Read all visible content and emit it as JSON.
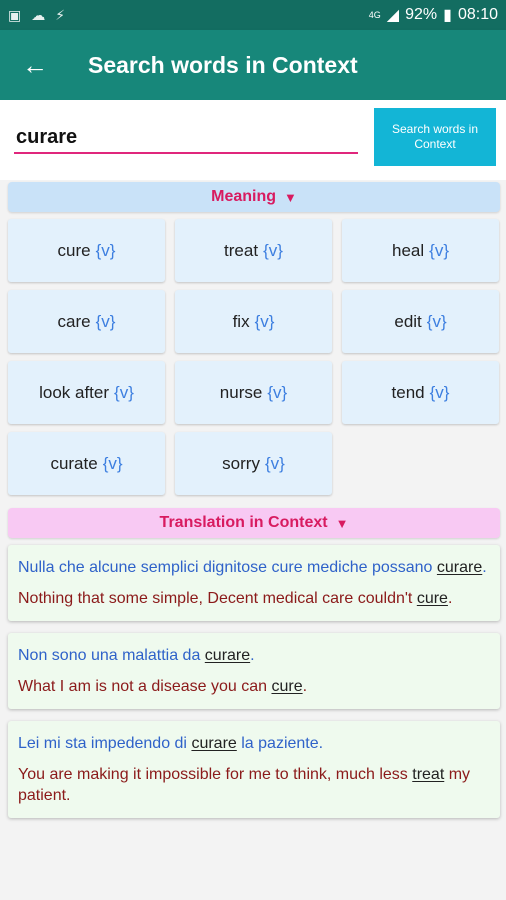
{
  "status": {
    "network": "4G",
    "battery": "92%",
    "time": "08:10"
  },
  "appbar": {
    "title": "Search words in Context"
  },
  "search": {
    "value": "curare",
    "button_label": "Search words in Context"
  },
  "meaning": {
    "label": "Meaning",
    "items": [
      {
        "word": "cure",
        "pos": "{v}"
      },
      {
        "word": "treat",
        "pos": "{v}"
      },
      {
        "word": "heal",
        "pos": "{v}"
      },
      {
        "word": "care",
        "pos": "{v}"
      },
      {
        "word": "fix",
        "pos": "{v}"
      },
      {
        "word": "edit",
        "pos": "{v}"
      },
      {
        "word": "look after",
        "pos": "{v}"
      },
      {
        "word": "nurse",
        "pos": "{v}"
      },
      {
        "word": "tend",
        "pos": "{v}"
      },
      {
        "word": "curate",
        "pos": "{v}"
      },
      {
        "word": "sorry",
        "pos": "{v}"
      }
    ]
  },
  "translation": {
    "label": "Translation in Context",
    "examples": [
      {
        "src_before": "Nulla che alcune semplici dignitose cure mediche possano ",
        "src_key": "curare",
        "src_after": ".",
        "tgt_before": "Nothing that some simple, Decent medical care couldn't ",
        "tgt_key": "cure",
        "tgt_after": "."
      },
      {
        "src_before": "Non sono una malattia da ",
        "src_key": "curare",
        "src_after": ".",
        "tgt_before": "What I am is not a disease you can ",
        "tgt_key": "cure",
        "tgt_after": "."
      },
      {
        "src_before": "Lei mi sta impedendo di ",
        "src_key": "curare",
        "src_after": " la paziente.",
        "tgt_before": "You are making it impossible for me to think, much less ",
        "tgt_key": "treat",
        "tgt_after": " my patient."
      }
    ]
  }
}
